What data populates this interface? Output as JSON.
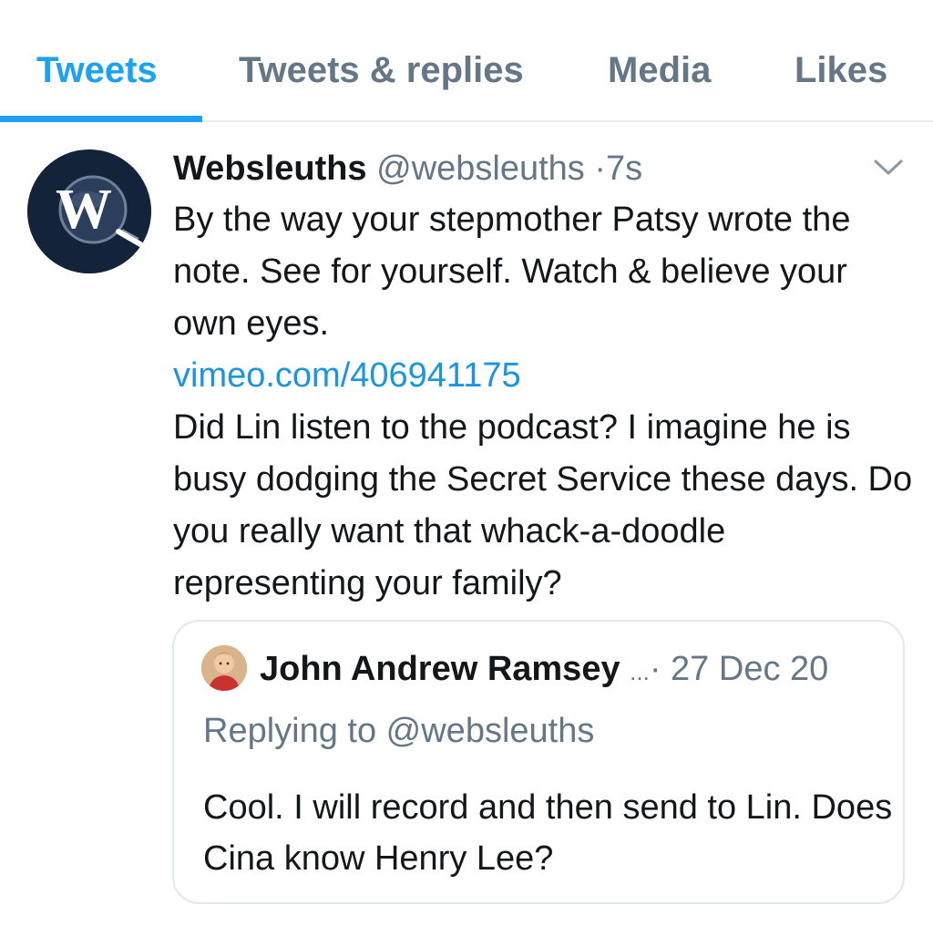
{
  "tabs": [
    {
      "label": "Tweets",
      "active": true
    },
    {
      "label": "Tweets & replies",
      "active": false
    },
    {
      "label": "Media",
      "active": false
    },
    {
      "label": "Likes",
      "active": false
    }
  ],
  "colors": {
    "accent": "#1da1f2",
    "link": "#1b95e0",
    "muted": "#657786",
    "text": "#14171a",
    "border": "#e1e8ed"
  },
  "tweet": {
    "display_name": "Websleuths",
    "handle": "@websleuths",
    "separator": "·",
    "time": "7s",
    "avatar_letter": "W",
    "caret_icon": "chevron-down-icon",
    "text_1": "By the way your stepmother Patsy wrote the note. See for yourself. Watch & believe your own eyes.",
    "link": "vimeo.com/406941175",
    "text_2": "Did Lin listen to the podcast? I imagine he is busy dodging the Secret Service these days. Do you really want that whack-a-doodle representing your family?"
  },
  "quote": {
    "display_name": "John Andrew Ramsey",
    "ellipsis": "...",
    "separator": "·",
    "date": "27 Dec 20",
    "replying_to": "Replying to @websleuths",
    "text": "Cool. I will record and then send to Lin. Does Cina know Henry Lee?"
  }
}
